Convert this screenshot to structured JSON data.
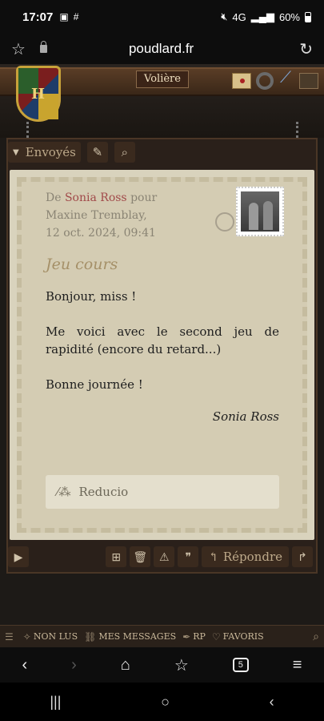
{
  "status_bar": {
    "time": "17:07",
    "network": "4G",
    "battery": "60%"
  },
  "browser": {
    "url": "poudlard.fr"
  },
  "header": {
    "voliere_label": "Volière"
  },
  "mailbox": {
    "folder_label": "Envoyés"
  },
  "letter": {
    "from_prefix": "De",
    "sender": "Sonia Ross",
    "pour": "pour",
    "recipient": "Maxine Tremblay,",
    "date": "12 oct. 2024, 09:41",
    "subject": "Jeu cours",
    "greeting": "Bonjour, miss !",
    "paragraph": "Me voici avec le second jeu de rapidité (encore du retard...)",
    "closing": "Bonne journée !",
    "signature": "Sonia Ross",
    "reducio_label": "Reducio"
  },
  "actions": {
    "reply_label": "Répondre"
  },
  "footer_nav": {
    "items": [
      "NON LUS",
      "MES MESSAGES",
      "RP",
      "FAVORIS"
    ]
  },
  "browser_nav": {
    "tab_count": "5"
  }
}
